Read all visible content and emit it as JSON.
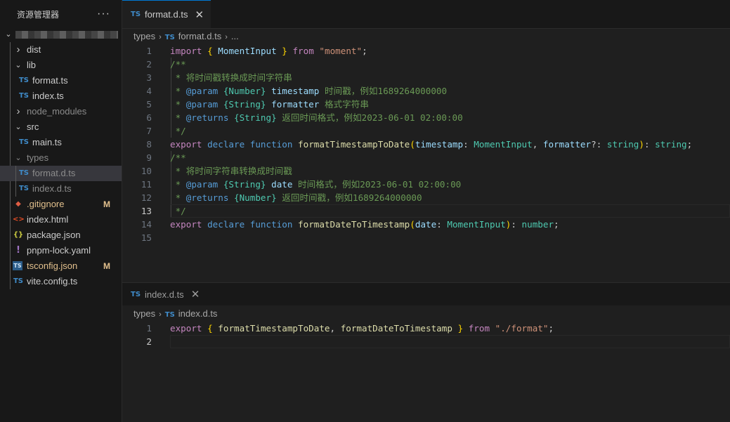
{
  "explorer": {
    "title": "资源管理器",
    "more": "···",
    "items": [
      {
        "name": "dist",
        "type": "folder",
        "open": false
      },
      {
        "name": "lib",
        "type": "folder",
        "open": true
      },
      {
        "name": "format.ts",
        "type": "ts"
      },
      {
        "name": "index.ts",
        "type": "ts"
      },
      {
        "name": "node_modules",
        "type": "folder",
        "open": false
      },
      {
        "name": "src",
        "type": "folder",
        "open": true
      },
      {
        "name": "main.ts",
        "type": "ts"
      },
      {
        "name": "types",
        "type": "folder",
        "open": true
      },
      {
        "name": "format.d.ts",
        "type": "ts"
      },
      {
        "name": "index.d.ts",
        "type": "ts"
      },
      {
        "name": ".gitignore",
        "badge": "M"
      },
      {
        "name": "index.html"
      },
      {
        "name": "package.json"
      },
      {
        "name": "pnpm-lock.yaml"
      },
      {
        "name": "tsconfig.json",
        "badge": "M"
      },
      {
        "name": "vite.config.ts"
      }
    ]
  },
  "icons": {
    "ts": "TS",
    "gitignore": "◆",
    "html": "<>",
    "json": "{}",
    "yaml": "!",
    "tsconfig": "TS",
    "chevron_right": "›",
    "chevron_down": "⌄"
  },
  "colors": {
    "ts": "#3f8bc9",
    "modified": "#e2c08d",
    "git": "#e05d44",
    "html": "#e44d26",
    "json": "#cbcb41",
    "yaml": "#a074c4",
    "accent": "#0078d4"
  },
  "editor1": {
    "tab": {
      "icon": "TS",
      "label": "format.d.ts",
      "close": "✕"
    },
    "breadcrumb": {
      "folder": "types",
      "file": "format.d.ts",
      "tail": "..."
    },
    "line_numbers": [
      "1",
      "2",
      "3",
      "4",
      "5",
      "6",
      "7",
      "8",
      "9",
      "10",
      "11",
      "12",
      "13",
      "14",
      "15"
    ],
    "current_line": "13",
    "lines": [
      [
        [
          "kc",
          "import"
        ],
        [
          "p",
          " "
        ],
        [
          "b1",
          "{"
        ],
        [
          "p",
          " "
        ],
        [
          "v",
          "MomentInput"
        ],
        [
          "p",
          " "
        ],
        [
          "b1",
          "}"
        ],
        [
          "p",
          " "
        ],
        [
          "kc",
          "from"
        ],
        [
          "p",
          " "
        ],
        [
          "s",
          "\"moment\""
        ],
        [
          "p",
          ";"
        ]
      ],
      [
        [
          "c",
          "/**"
        ]
      ],
      [
        [
          "c",
          " * 将时间戳转换成时间字符串"
        ]
      ],
      [
        [
          "c",
          " * "
        ],
        [
          "ckw",
          "@param"
        ],
        [
          "c",
          " "
        ],
        [
          "ct",
          "{Number}"
        ],
        [
          "c",
          " "
        ],
        [
          "cv",
          "timestamp"
        ],
        [
          "c",
          " 时间戳，例如1689264000000"
        ]
      ],
      [
        [
          "c",
          " * "
        ],
        [
          "ckw",
          "@param"
        ],
        [
          "c",
          " "
        ],
        [
          "ct",
          "{String}"
        ],
        [
          "c",
          " "
        ],
        [
          "cv",
          "formatter"
        ],
        [
          "c",
          " 格式字符串"
        ]
      ],
      [
        [
          "c",
          " * "
        ],
        [
          "ckw",
          "@returns"
        ],
        [
          "c",
          " "
        ],
        [
          "ct",
          "{String}"
        ],
        [
          "c",
          " 返回时间格式，例如2023-06-01 02:00:00"
        ]
      ],
      [
        [
          "c",
          " */"
        ]
      ],
      [
        [
          "kc",
          "export"
        ],
        [
          "p",
          " "
        ],
        [
          "k",
          "declare"
        ],
        [
          "p",
          " "
        ],
        [
          "k",
          "function"
        ],
        [
          "p",
          " "
        ],
        [
          "f",
          "formatTimestampToDate"
        ],
        [
          "b1",
          "("
        ],
        [
          "v",
          "timestamp"
        ],
        [
          "p",
          ": "
        ],
        [
          "t",
          "MomentInput"
        ],
        [
          "p",
          ", "
        ],
        [
          "v",
          "formatter"
        ],
        [
          "p",
          "?: "
        ],
        [
          "t",
          "string"
        ],
        [
          "b1",
          ")"
        ],
        [
          "p",
          ": "
        ],
        [
          "t",
          "string"
        ],
        [
          "p",
          ";"
        ]
      ],
      [
        [
          "c",
          "/**"
        ]
      ],
      [
        [
          "c",
          " * 将时间字符串转换成时间戳"
        ]
      ],
      [
        [
          "c",
          " * "
        ],
        [
          "ckw",
          "@param"
        ],
        [
          "c",
          " "
        ],
        [
          "ct",
          "{String}"
        ],
        [
          "c",
          " "
        ],
        [
          "cv",
          "date"
        ],
        [
          "c",
          " 时间格式，例如2023-06-01 02:00:00"
        ]
      ],
      [
        [
          "c",
          " * "
        ],
        [
          "ckw",
          "@returns"
        ],
        [
          "c",
          " "
        ],
        [
          "ct",
          "{Number}"
        ],
        [
          "c",
          " 返回时间戳，例如1689264000000"
        ]
      ],
      [
        [
          "c",
          " */"
        ]
      ],
      [
        [
          "kc",
          "export"
        ],
        [
          "p",
          " "
        ],
        [
          "k",
          "declare"
        ],
        [
          "p",
          " "
        ],
        [
          "k",
          "function"
        ],
        [
          "p",
          " "
        ],
        [
          "f",
          "formatDateToTimestamp"
        ],
        [
          "b1",
          "("
        ],
        [
          "v",
          "date"
        ],
        [
          "p",
          ": "
        ],
        [
          "t",
          "MomentInput"
        ],
        [
          "b1",
          ")"
        ],
        [
          "p",
          ": "
        ],
        [
          "t",
          "number"
        ],
        [
          "p",
          ";"
        ]
      ],
      []
    ]
  },
  "editor2": {
    "tab": {
      "icon": "TS",
      "label": "index.d.ts",
      "close": "✕"
    },
    "breadcrumb": {
      "folder": "types",
      "file": "index.d.ts"
    },
    "line_numbers": [
      "1",
      "2"
    ],
    "current_line": "2",
    "lines": [
      [
        [
          "kc",
          "export"
        ],
        [
          "p",
          " "
        ],
        [
          "b1",
          "{"
        ],
        [
          "p",
          " "
        ],
        [
          "f",
          "formatTimestampToDate"
        ],
        [
          "p",
          ", "
        ],
        [
          "f",
          "formatDateToTimestamp"
        ],
        [
          "p",
          " "
        ],
        [
          "b1",
          "}"
        ],
        [
          "p",
          " "
        ],
        [
          "kc",
          "from"
        ],
        [
          "p",
          " "
        ],
        [
          "s",
          "\"./format\""
        ],
        [
          "p",
          ";"
        ]
      ],
      []
    ]
  }
}
